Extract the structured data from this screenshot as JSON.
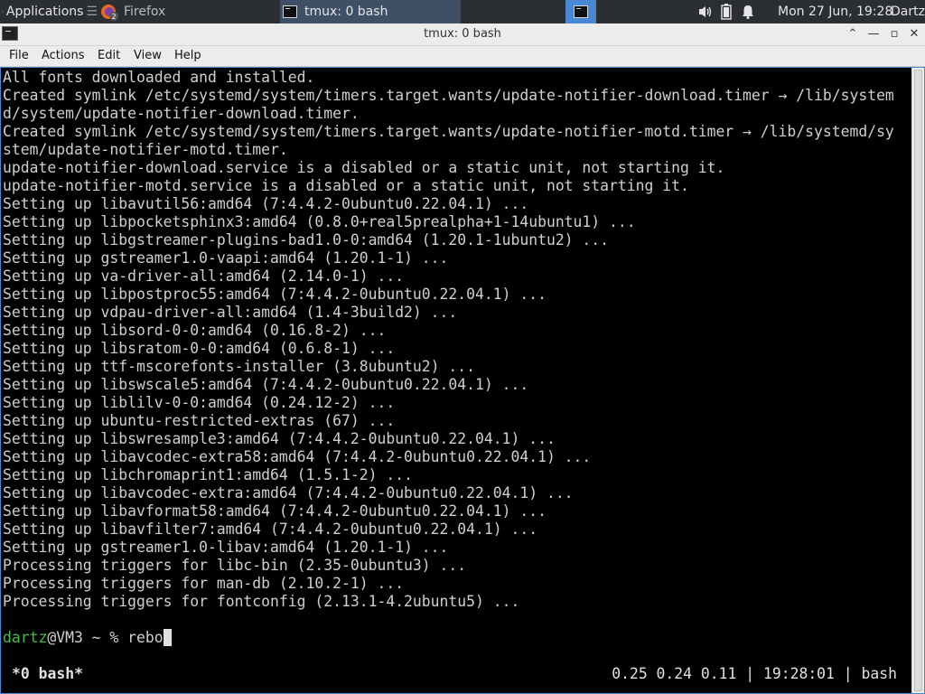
{
  "panel": {
    "applications_label": "Applications",
    "firefox_label": "Firefox",
    "tmux_task_label": "tmux: 0 bash",
    "clock": "Mon 27 Jun, 19:28",
    "user": "Dartz"
  },
  "window": {
    "title": "tmux: 0 bash",
    "buttons": {
      "shade": "⌃",
      "minimize": "—",
      "maximize": "▫",
      "close": "✕"
    }
  },
  "menubar": [
    "File",
    "Actions",
    "Edit",
    "View",
    "Help"
  ],
  "terminal": {
    "lines": [
      "All fonts downloaded and installed.",
      "Created symlink /etc/systemd/system/timers.target.wants/update-notifier-download.timer → /lib/system",
      "d/system/update-notifier-download.timer.",
      "Created symlink /etc/systemd/system/timers.target.wants/update-notifier-motd.timer → /lib/systemd/sy",
      "stem/update-notifier-motd.timer.",
      "update-notifier-download.service is a disabled or a static unit, not starting it.",
      "update-notifier-motd.service is a disabled or a static unit, not starting it.",
      "Setting up libavutil56:amd64 (7:4.4.2-0ubuntu0.22.04.1) ...",
      "Setting up libpocketsphinx3:amd64 (0.8.0+real5prealpha+1-14ubuntu1) ...",
      "Setting up libgstreamer-plugins-bad1.0-0:amd64 (1.20.1-1ubuntu2) ...",
      "Setting up gstreamer1.0-vaapi:amd64 (1.20.1-1) ...",
      "Setting up va-driver-all:amd64 (2.14.0-1) ...",
      "Setting up libpostproc55:amd64 (7:4.4.2-0ubuntu0.22.04.1) ...",
      "Setting up vdpau-driver-all:amd64 (1.4-3build2) ...",
      "Setting up libsord-0-0:amd64 (0.16.8-2) ...",
      "Setting up libsratom-0-0:amd64 (0.6.8-1) ...",
      "Setting up ttf-mscorefonts-installer (3.8ubuntu2) ...",
      "Setting up libswscale5:amd64 (7:4.4.2-0ubuntu0.22.04.1) ...",
      "Setting up liblilv-0-0:amd64 (0.24.12-2) ...",
      "Setting up ubuntu-restricted-extras (67) ...",
      "Setting up libswresample3:amd64 (7:4.4.2-0ubuntu0.22.04.1) ...",
      "Setting up libavcodec-extra58:amd64 (7:4.4.2-0ubuntu0.22.04.1) ...",
      "Setting up libchromaprint1:amd64 (1.5.1-2) ...",
      "Setting up libavcodec-extra:amd64 (7:4.4.2-0ubuntu0.22.04.1) ...",
      "Setting up libavformat58:amd64 (7:4.4.2-0ubuntu0.22.04.1) ...",
      "Setting up libavfilter7:amd64 (7:4.4.2-0ubuntu0.22.04.1) ...",
      "Setting up gstreamer1.0-libav:amd64 (1.20.1-1) ...",
      "Processing triggers for libc-bin (2.35-0ubuntu3) ...",
      "Processing triggers for man-db (2.10.2-1) ...",
      "Processing triggers for fontconfig (2.13.1-4.2ubuntu5) ..."
    ],
    "prompt_user": "dartz",
    "prompt_rest": "@VM3 ~ % ",
    "command": "rebo"
  },
  "status": {
    "window": "*0 bash*",
    "right": "0.25 0.24 0.11 | 19:28:01 | bash"
  },
  "colors": {
    "panel_bg": "#2b2e33",
    "active_task": "#4a88d4",
    "prompt_user": "#49b94a",
    "terminal_bg": "#000000"
  }
}
